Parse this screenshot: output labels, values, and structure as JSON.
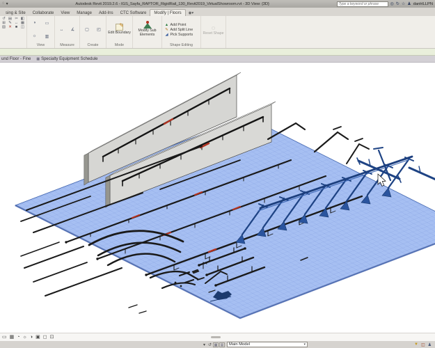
{
  "title_bar": {
    "qat_icons": [
      "◌",
      "▾"
    ],
    "title": "Autodesk Revit 2019.2.6 - IGS_Sayfa_RAPTOR_RigidRail_130_Revit2019_VirtualShowroom.rvt - 3D View: {3D}",
    "search": {
      "placeholder": "Type a keyword or phrase"
    },
    "icons": {
      "search": "◎",
      "sync": "↻",
      "favorites": "☆",
      "user": "♟"
    },
    "user_name": "danHLLPN"
  },
  "ribbon": {
    "tabs": [
      "sing & Site",
      "Collaborate",
      "View",
      "Manage",
      "Add-Ins",
      "CTC Software",
      "Modify | Floors"
    ],
    "active_tab": "Modify | Floors",
    "overflow_icon": "◉▾",
    "left_tools": [
      "↺",
      "▤",
      "✂",
      "◧",
      "⊞",
      "✎",
      "↔",
      "▦",
      "▧",
      "✕",
      "■",
      "◫"
    ],
    "panels": {
      "view": {
        "label": "View",
        "icons": [
          "◑",
          "▭",
          "☼",
          "▥"
        ]
      },
      "measure": {
        "label": "Measure",
        "icons": [
          "↔",
          "∡"
        ]
      },
      "create": {
        "label": "Create",
        "icons": [
          "▢",
          "◰"
        ]
      },
      "mode": {
        "label": "Mode",
        "button": "Edit Boundary",
        "icon": "✎"
      },
      "modify_sub": {
        "button": "Modify Sub Elements"
      },
      "shape_editing": {
        "label": "Shape Editing",
        "items": [
          {
            "icon": "▲",
            "label": "Add Point"
          },
          {
            "icon": "✎",
            "label": "Add Split Line"
          },
          {
            "icon": "◢",
            "label": "Pick Supports"
          }
        ]
      },
      "reset": {
        "button": "Reset Shape",
        "icon": "◌"
      }
    }
  },
  "view_tabs": [
    {
      "label": "und Floor - Fine"
    },
    {
      "icon": "▦",
      "label": "Specialty Equipment Schedule"
    }
  ],
  "viewport": {
    "floor_color": "#a6bff2",
    "selection_grid_color": "#7b97dd",
    "rail_color": "#1a1a1a",
    "truss_color": "#1e4384",
    "wall_color": "#d7d7d4",
    "marker_color": "#b23220"
  },
  "view_control_bar": {
    "icons": [
      "▭",
      "▦",
      "◔",
      "☼",
      "◑",
      "▣",
      "◻",
      "⊡"
    ]
  },
  "status_bar": {
    "icons_left": [
      "▾",
      "↺"
    ],
    "workset_icons": [
      "▦",
      "▤"
    ],
    "design_option": "Main Model",
    "dropdown_caret": "▾",
    "right_icons": {
      "filter": "▼",
      "options": "◫",
      "user": "♟"
    }
  }
}
